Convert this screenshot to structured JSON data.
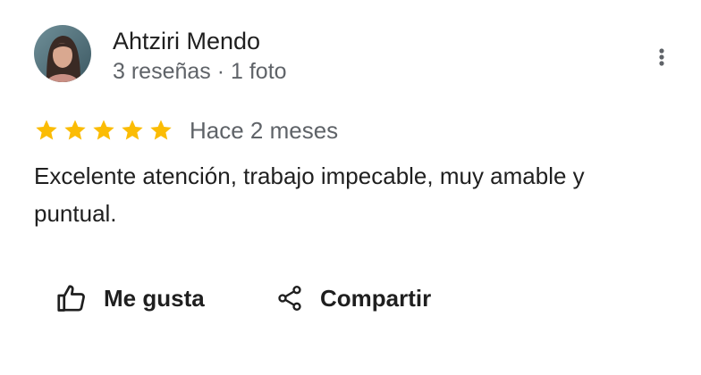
{
  "reviewer": {
    "name": "Ahtziri Mendo",
    "meta": "3 reseñas · 1 foto"
  },
  "review": {
    "rating": 5,
    "max_rating": 5,
    "date": "Hace 2 meses",
    "text": "Excelente atención, trabajo impecable, muy amable y puntual."
  },
  "actions": {
    "like_label": "Me gusta",
    "share_label": "Compartir"
  },
  "icons": {
    "more": "more-vert-icon",
    "like": "thumbs-up-icon",
    "share": "share-icon",
    "star": "star-icon"
  },
  "colors": {
    "star": "#fbbc04",
    "text_primary": "#1f1f1f",
    "text_secondary": "#5f6368"
  }
}
